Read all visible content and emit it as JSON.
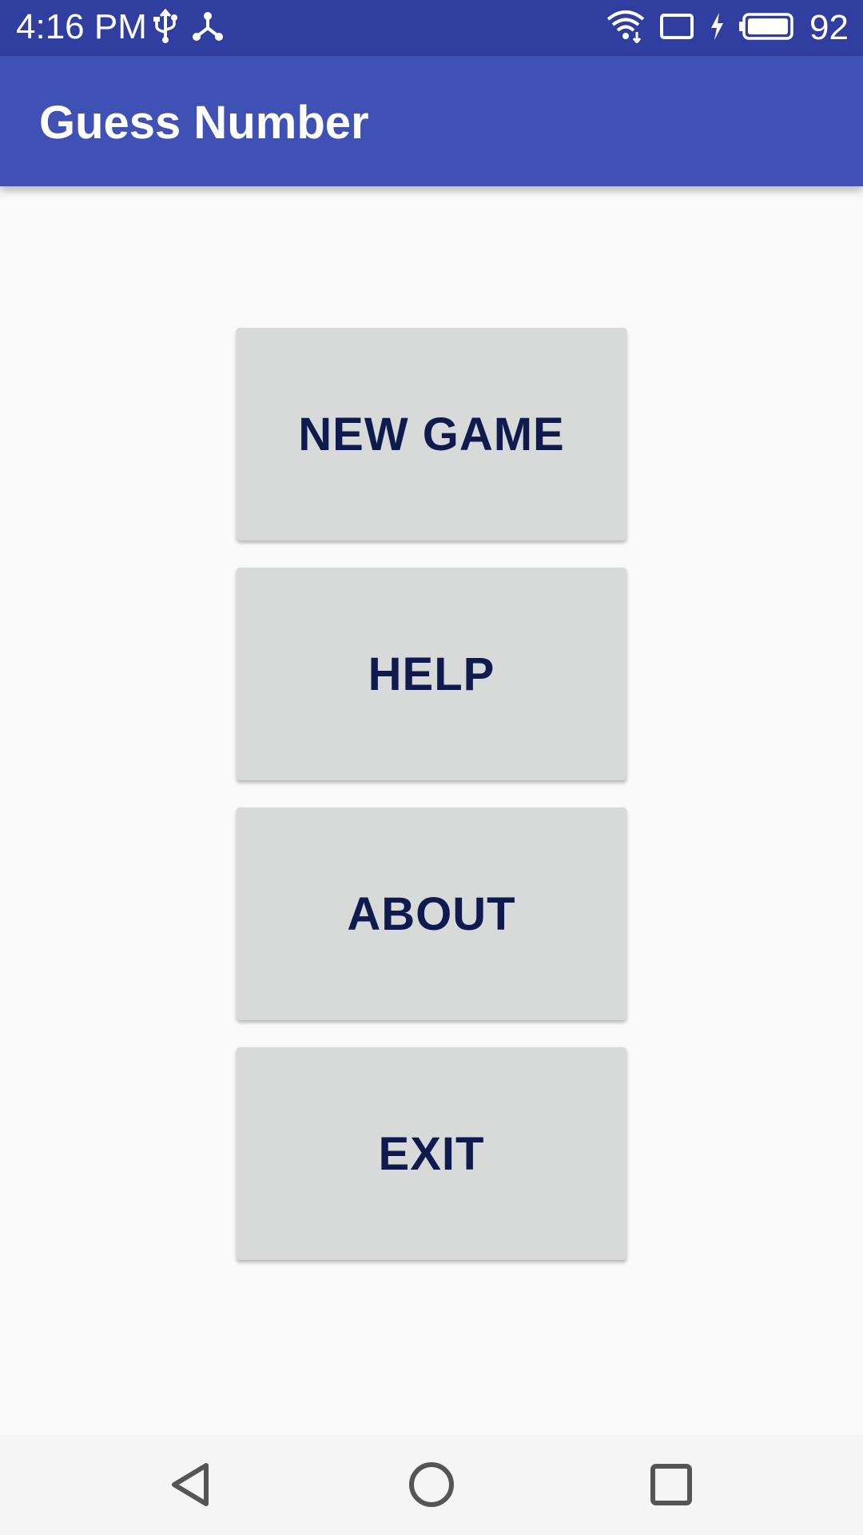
{
  "status_bar": {
    "time": "4:16 PM",
    "battery_level": "92",
    "icons": [
      "usb-icon",
      "share-icon",
      "wifi-icon",
      "tablet-icon",
      "charging-icon",
      "battery-icon"
    ],
    "background_color": "#303f9f"
  },
  "app_bar": {
    "title": "Guess Number",
    "background_color": "#3f51b5"
  },
  "menu": {
    "buttons": [
      {
        "label": "NEW GAME"
      },
      {
        "label": "HELP"
      },
      {
        "label": "ABOUT"
      },
      {
        "label": "EXIT"
      }
    ],
    "button_color": "#d8d9d9",
    "text_color": "#0f1a4f"
  },
  "nav_bar": {
    "icons": [
      "back-icon",
      "home-icon",
      "recents-icon"
    ]
  }
}
